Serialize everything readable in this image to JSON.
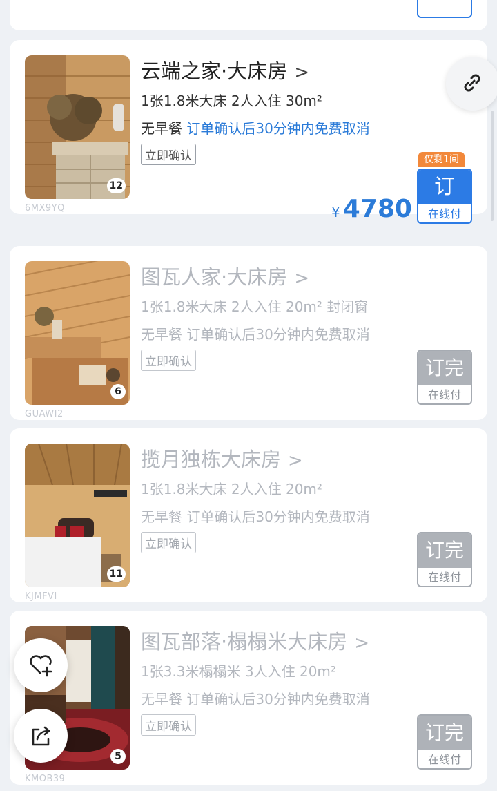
{
  "rooms": [
    {
      "title": "云端之家·大床房",
      "spec": "1张1.8米大床 2人入住 30m²",
      "policy_meal": "无早餐",
      "policy_cancel": "订单确认后30分钟内免费取消",
      "confirm_tag": "立即确认",
      "photo_count": "12",
      "code": "6MX9YQ",
      "badge": "仅剩1间",
      "currency": "¥",
      "price": "4780",
      "button_main": "订",
      "button_sub": "在线付",
      "status": "available"
    },
    {
      "title": "图瓦人家·大床房",
      "spec": "1张1.8米大床 2人入住 20m² 封闭窗",
      "policy_meal": "无早餐",
      "policy_cancel": "订单确认后30分钟内免费取消",
      "confirm_tag": "立即确认",
      "photo_count": "6",
      "code": "GUAWI2",
      "button_main": "订完",
      "button_sub": "在线付",
      "status": "sold_out"
    },
    {
      "title": "揽月独栋大床房",
      "spec": "1张1.8米大床 2人入住 20m²",
      "policy_meal": "无早餐",
      "policy_cancel": "订单确认后30分钟内免费取消",
      "confirm_tag": "立即确认",
      "photo_count": "11",
      "code": "KJMFVI",
      "button_main": "订完",
      "button_sub": "在线付",
      "status": "sold_out"
    },
    {
      "title": "图瓦部落·榻榻米大床房",
      "spec": "1张3.3米榻榻米 3人入住 20m²",
      "policy_meal": "无早餐",
      "policy_cancel": "订单确认后30分钟内免费取消",
      "confirm_tag": "立即确认",
      "photo_count": "5",
      "code": "KMOB39",
      "button_main": "订完",
      "button_sub": "在线付",
      "status": "sold_out"
    }
  ],
  "chevron": ">",
  "icons": {
    "share_link": "link-icon",
    "favorite": "heart-plus-icon",
    "share": "share-arrow-icon"
  },
  "colors": {
    "accent": "#2c7be5",
    "badge": "#f2883a",
    "disabled": "#aeb2b8"
  }
}
